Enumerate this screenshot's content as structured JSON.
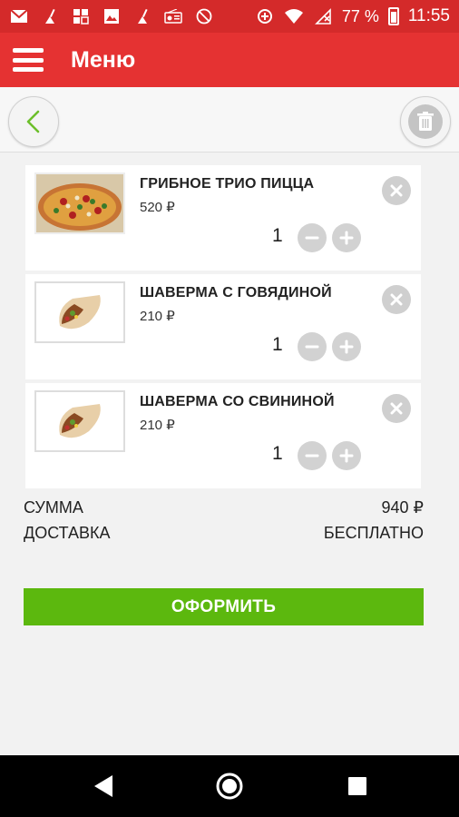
{
  "status_bar": {
    "battery": "77 %",
    "time": "11:55",
    "icons": [
      "mail-icon",
      "broom-icon",
      "grid-icon",
      "image-icon",
      "broom-icon",
      "radio-icon",
      "no-sim-icon"
    ]
  },
  "app_bar": {
    "title": "Меню"
  },
  "cart": {
    "items": [
      {
        "name": "ГРИБНОЕ ТРИО ПИЦЦА",
        "price": "520 ₽",
        "qty": "1"
      },
      {
        "name": "ШАВЕРМА С ГОВЯДИНОЙ",
        "price": "210 ₽",
        "qty": "1"
      },
      {
        "name": "ШАВЕРМА СО СВИНИНОЙ",
        "price": "210 ₽",
        "qty": "1"
      }
    ]
  },
  "summary": {
    "sum_label": "СУММА",
    "sum_value": "940 ₽",
    "delivery_label": "ДОСТАВКА",
    "delivery_value": "БЕСПЛАТНО"
  },
  "checkout_label": "ОФОРМИТЬ",
  "colors": {
    "primary": "#e53232",
    "status_bar": "#d42a2a",
    "accent": "#5cb80e",
    "back_arrow": "#6cbf2a"
  }
}
